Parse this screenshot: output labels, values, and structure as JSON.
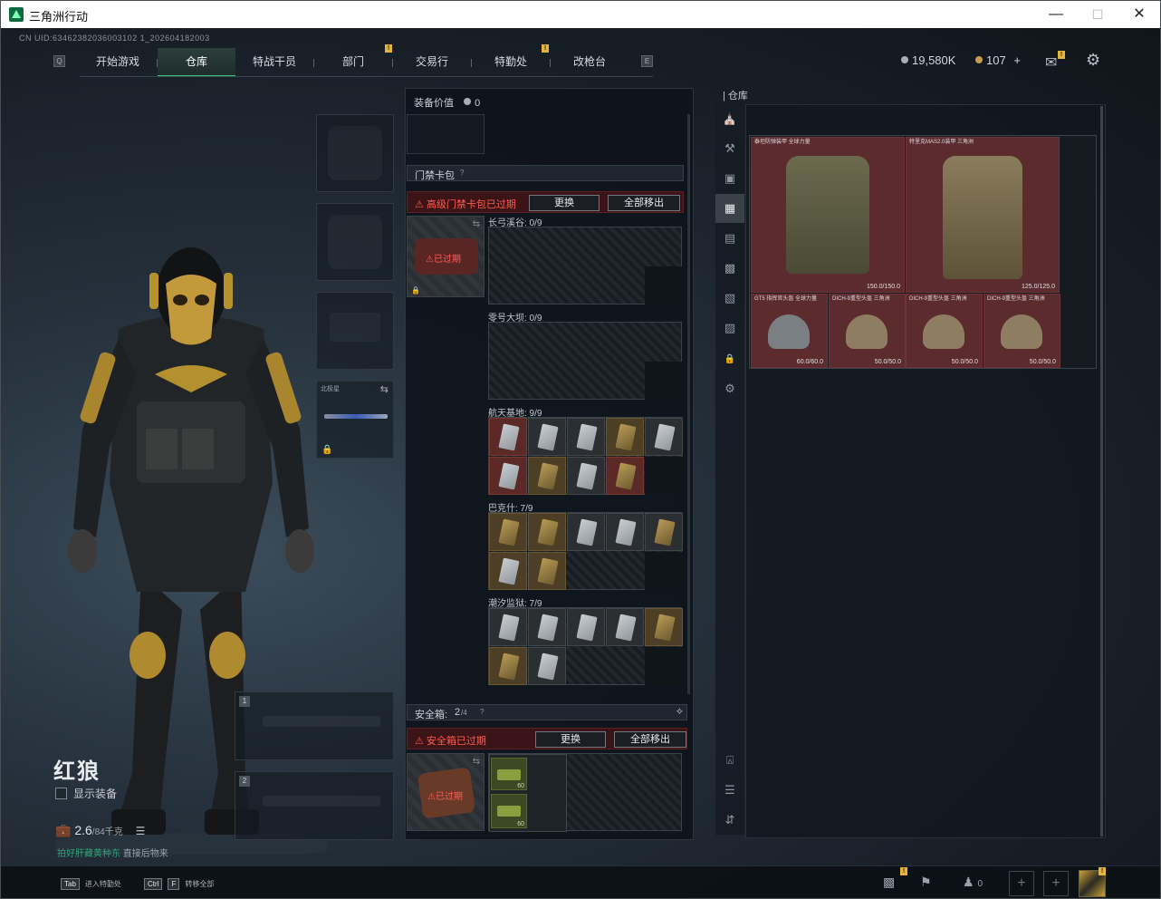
{
  "window": {
    "title": "三角洲行动"
  },
  "header": {
    "uid": "CN UID:63462382036003102 1_202604182003",
    "tabs": [
      {
        "label": "开始游戏"
      },
      {
        "label": "仓库"
      },
      {
        "label": "特战干员"
      },
      {
        "label": "部门"
      },
      {
        "label": "交易行"
      },
      {
        "label": "特勤处"
      },
      {
        "label": "改枪台"
      }
    ],
    "currency_main": "19,580K",
    "currency_premium": "107",
    "plus": "+"
  },
  "character": {
    "name": "红狼",
    "show_equipment": "显示装备",
    "weight_value": "2.6",
    "weight_max": "/84千克",
    "hint_green": "拍好肝藏黄种东",
    "hint_gray": "直接后物来",
    "weapon_slot_label": "北极星",
    "slot_numbers": [
      "1",
      "2"
    ]
  },
  "middle": {
    "equip_value_label": "装备价值",
    "equip_value": "0",
    "keycase_title": "门禁卡包",
    "keycase_help": "?",
    "keycase_alert": "高级门禁卡包已过期",
    "replace": "更换",
    "remove_all": "全部移出",
    "expired": "已过期",
    "maps": [
      {
        "label": "长弓溪谷: 0/9"
      },
      {
        "label": "零号大坝: 0/9"
      },
      {
        "label": "航天基地: 9/9"
      },
      {
        "label": "巴克什: 7/9"
      },
      {
        "label": "潮汐监狱: 7/9"
      }
    ],
    "safebox_title": "安全箱:",
    "safebox_count": "2",
    "safebox_total": "/4",
    "safebox_alert": "安全箱已过期",
    "safebox_item_top": "60",
    "safebox_item_bottom": "60"
  },
  "warehouse": {
    "title": "仓库",
    "items": [
      {
        "name": "泰坦防弹装甲 全球力量",
        "durability": "150.0/150.0"
      },
      {
        "name": "特里克MAS2.0装甲 三角洲",
        "durability": "125.0/125.0"
      },
      {
        "name": "GT5 指挥官头盔 全球力量",
        "durability": "60.0/60.0"
      },
      {
        "name": "DICH-9重型头盔 三角洲",
        "durability": "50.0/50.0"
      },
      {
        "name": "DICH-9重型头盔 三角洲",
        "durability": "50.0/50.0"
      },
      {
        "name": "DICH-9重型头盔 三角洲",
        "durability": "50.0/50.0"
      }
    ]
  },
  "statusbar": {
    "key1": "Tab",
    "label1": "进入特勤处",
    "key2": "Ctrl",
    "key3": "F",
    "label2": "转移全部",
    "friends_count": "0"
  },
  "colors": {
    "accent": "#36c97f",
    "alert": "#ff5a52",
    "badge": "#e6b43a"
  }
}
